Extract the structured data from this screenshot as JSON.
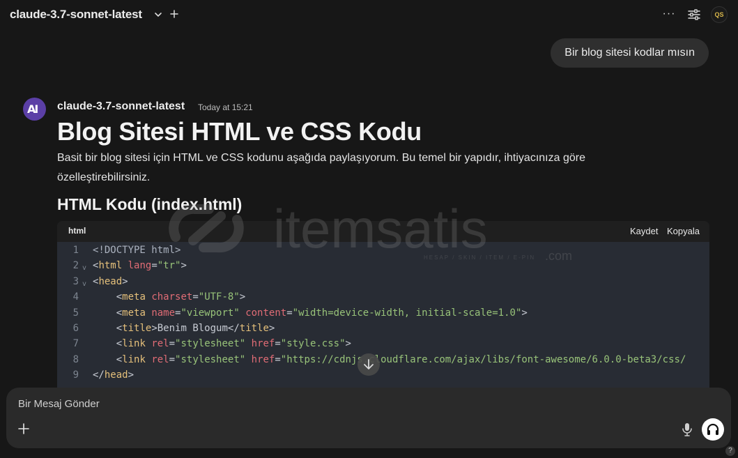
{
  "header": {
    "model_name": "claude-3.7-sonnet-latest",
    "menu_icon": "ellipsis-icon",
    "settings_icon": "sliders-icon",
    "user_initials": "QS"
  },
  "conversation": {
    "user_message": "Bir blog sitesi kodlar mısın",
    "assistant": {
      "name": "claude-3.7-sonnet-latest",
      "time": "Today at 15:21",
      "avatar_text": "AI",
      "heading": "Blog Sitesi HTML ve CSS Kodu",
      "paragraph": "Basit bir blog sitesi için HTML ve CSS kodunu aşağıda paylaşıyorum. Bu temel bir yapıdır, ihtiyacınıza göre özelleştirebilirsiniz.",
      "subheading": "HTML Kodu (index.html)"
    }
  },
  "code_block": {
    "language": "html",
    "save_label": "Kaydet",
    "copy_label": "Kopyala",
    "lines": [
      {
        "n": "1",
        "fold": "",
        "parts": [
          [
            "doc",
            "<!DOCTYPE html>"
          ]
        ]
      },
      {
        "n": "2",
        "fold": "v",
        "parts": [
          [
            "punc",
            "<"
          ],
          [
            "tag",
            "html"
          ],
          [
            "plain",
            " "
          ],
          [
            "attr",
            "lang"
          ],
          [
            "punc",
            "="
          ],
          [
            "str",
            "\"tr\""
          ],
          [
            "punc",
            ">"
          ]
        ]
      },
      {
        "n": "3",
        "fold": "v",
        "parts": [
          [
            "punc",
            "<"
          ],
          [
            "tag",
            "head"
          ],
          [
            "punc",
            ">"
          ]
        ]
      },
      {
        "n": "4",
        "fold": "",
        "parts": [
          [
            "plain",
            "    "
          ],
          [
            "punc",
            "<"
          ],
          [
            "tag",
            "meta"
          ],
          [
            "plain",
            " "
          ],
          [
            "attr",
            "charset"
          ],
          [
            "punc",
            "="
          ],
          [
            "str",
            "\"UTF-8\""
          ],
          [
            "punc",
            ">"
          ]
        ]
      },
      {
        "n": "5",
        "fold": "",
        "parts": [
          [
            "plain",
            "    "
          ],
          [
            "punc",
            "<"
          ],
          [
            "tag",
            "meta"
          ],
          [
            "plain",
            " "
          ],
          [
            "attr",
            "name"
          ],
          [
            "punc",
            "="
          ],
          [
            "str",
            "\"viewport\""
          ],
          [
            "plain",
            " "
          ],
          [
            "attr",
            "content"
          ],
          [
            "punc",
            "="
          ],
          [
            "str",
            "\"width=device-width, initial-scale=1.0\""
          ],
          [
            "punc",
            ">"
          ]
        ]
      },
      {
        "n": "6",
        "fold": "",
        "parts": [
          [
            "plain",
            "    "
          ],
          [
            "punc",
            "<"
          ],
          [
            "tag",
            "title"
          ],
          [
            "punc",
            ">"
          ],
          [
            "plain",
            "Benim Blogum"
          ],
          [
            "punc",
            "</"
          ],
          [
            "tag",
            "title"
          ],
          [
            "punc",
            ">"
          ]
        ]
      },
      {
        "n": "7",
        "fold": "",
        "parts": [
          [
            "plain",
            "    "
          ],
          [
            "punc",
            "<"
          ],
          [
            "tag",
            "link"
          ],
          [
            "plain",
            " "
          ],
          [
            "attr",
            "rel"
          ],
          [
            "punc",
            "="
          ],
          [
            "str",
            "\"stylesheet\""
          ],
          [
            "plain",
            " "
          ],
          [
            "attr",
            "href"
          ],
          [
            "punc",
            "="
          ],
          [
            "str",
            "\"style.css\""
          ],
          [
            "punc",
            ">"
          ]
        ]
      },
      {
        "n": "8",
        "fold": "",
        "parts": [
          [
            "plain",
            "    "
          ],
          [
            "punc",
            "<"
          ],
          [
            "tag",
            "link"
          ],
          [
            "plain",
            " "
          ],
          [
            "attr",
            "rel"
          ],
          [
            "punc",
            "="
          ],
          [
            "str",
            "\"stylesheet\""
          ],
          [
            "plain",
            " "
          ],
          [
            "attr",
            "href"
          ],
          [
            "punc",
            "="
          ],
          [
            "str",
            "\"https://cdnjs.cloudflare.com/ajax/libs/font-awesome/6.0.0-beta3/css/"
          ]
        ]
      },
      {
        "n": "9",
        "fold": "",
        "parts": [
          [
            "punc",
            "</"
          ],
          [
            "tag",
            "head"
          ],
          [
            "punc",
            ">"
          ]
        ]
      }
    ]
  },
  "watermark": {
    "brand": "itemsatis",
    "tagline": "HESAP / SKIN / ITEM / E-PIN",
    "suffix": ".com"
  },
  "composer": {
    "placeholder": "Bir Mesaj Gönder",
    "add_icon": "plus-icon",
    "mic_icon": "microphone-icon",
    "voice_icon": "headphones-icon"
  },
  "help_label": "?",
  "colors": {
    "background": "#171717",
    "code_bg": "#282c34",
    "tag": "#e5c07b",
    "attr": "#e06c75",
    "string": "#98c379",
    "avatar": "#5b3fa6"
  }
}
